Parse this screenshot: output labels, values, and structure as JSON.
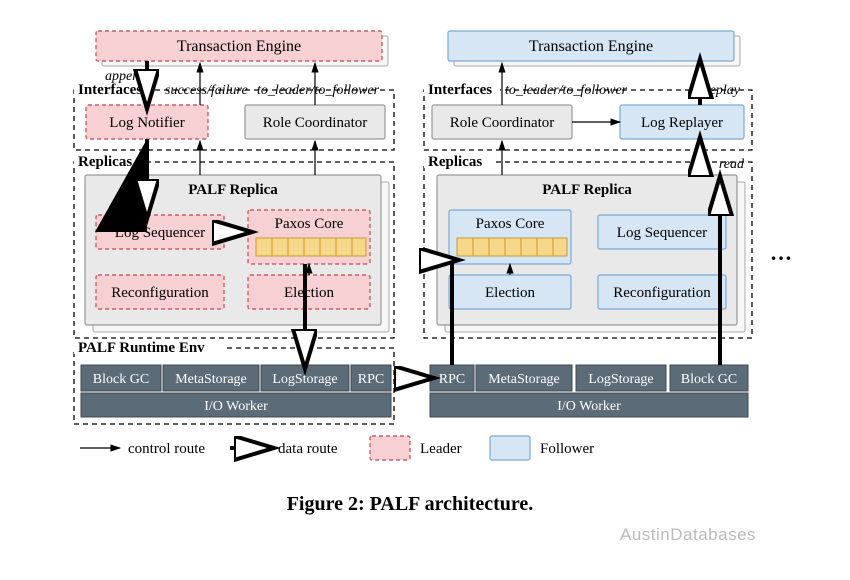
{
  "caption": "Figure 2: PALF architecture.",
  "watermark": "AustinDatabases",
  "legend": {
    "control": "control route",
    "data": "data route",
    "leader": "Leader",
    "follower": "Follower"
  },
  "left": {
    "te": "Transaction Engine",
    "interfaces": "Interfaces",
    "append": "append",
    "sf": "success/failure",
    "tltf": "to_leader/to_follower",
    "notifier": "Log Notifier",
    "role": "Role Coordinator",
    "replicas": "Replicas",
    "palf": "PALF Replica",
    "seq": "Log Sequencer",
    "paxos": "Paxos Core",
    "reconf": "Reconfiguration",
    "elect": "Election",
    "runtime": "PALF Runtime Env",
    "rt0": "Block GC",
    "rt1": "MetaStorage",
    "rt2": "LogStorage",
    "rt3": "RPC",
    "io": "I/O Worker"
  },
  "right": {
    "te": "Transaction Engine",
    "interfaces": "Interfaces",
    "tltf": "to_leader/to_follower",
    "replay": "replay",
    "role": "Role Coordinator",
    "replayer": "Log Replayer",
    "replicas": "Replicas",
    "read": "read",
    "palf": "PALF Replica",
    "paxos": "Paxos Core",
    "seq": "Log Sequencer",
    "elect": "Election",
    "reconf": "Reconfiguration",
    "rt0": "RPC",
    "rt1": "MetaStorage",
    "rt2": "LogStorage",
    "rt3": "Block GC",
    "io": "I/O Worker"
  },
  "colors": {
    "pink": "#f6d0d2",
    "blue": "#d6e6f5",
    "steel": "#5c6b78"
  }
}
